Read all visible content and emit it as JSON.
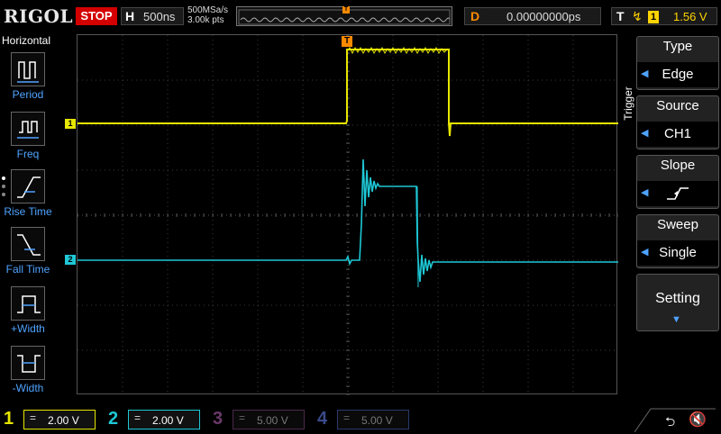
{
  "topbar": {
    "brand": "RIGOL",
    "run_state": "STOP",
    "h_label": "H",
    "timebase": "500ns",
    "sample_rate": "500MSa/s",
    "memory_points": "3.00k pts",
    "trigger_marker": "T",
    "d_label": "D",
    "delay": "0.00000000ps",
    "t_label": "T",
    "trigger_source_num": "1",
    "trigger_level": "1.56 V"
  },
  "left_panel": {
    "title": "Horizontal",
    "items": [
      {
        "label": "Period",
        "icon": "period-icon"
      },
      {
        "label": "Freq",
        "icon": "freq-icon"
      },
      {
        "label": "Rise Time",
        "icon": "rise-time-icon"
      },
      {
        "label": "Fall Time",
        "icon": "fall-time-icon"
      },
      {
        "label": "+Width",
        "icon": "pos-width-icon"
      },
      {
        "label": "-Width",
        "icon": "neg-width-icon"
      }
    ]
  },
  "screen": {
    "ch1_marker": "1",
    "ch2_marker": "2",
    "trigger_marker": "T",
    "colors": {
      "ch1": "#e6e600",
      "ch2": "#1ec8d6",
      "grid": "#3a3a3a",
      "trigger": "#ff8a00"
    }
  },
  "right_panel": {
    "title": "Trigger",
    "buttons": [
      {
        "title": "Type",
        "value": "Edge"
      },
      {
        "title": "Source",
        "value": "CH1"
      },
      {
        "title": "Slope",
        "value": ""
      },
      {
        "title": "Sweep",
        "value": "Single"
      }
    ],
    "setting": "Setting"
  },
  "bottombar": {
    "channels": [
      {
        "num": "1",
        "scale": "2.00 V",
        "color": "#e6e600",
        "active": true
      },
      {
        "num": "2",
        "scale": "2.00 V",
        "color": "#1ec8d6",
        "active": true
      },
      {
        "num": "3",
        "scale": "5.00 V",
        "color": "#8a3a8a",
        "active": false
      },
      {
        "num": "4",
        "scale": "5.00 V",
        "color": "#3a4a8a",
        "active": false
      }
    ]
  }
}
